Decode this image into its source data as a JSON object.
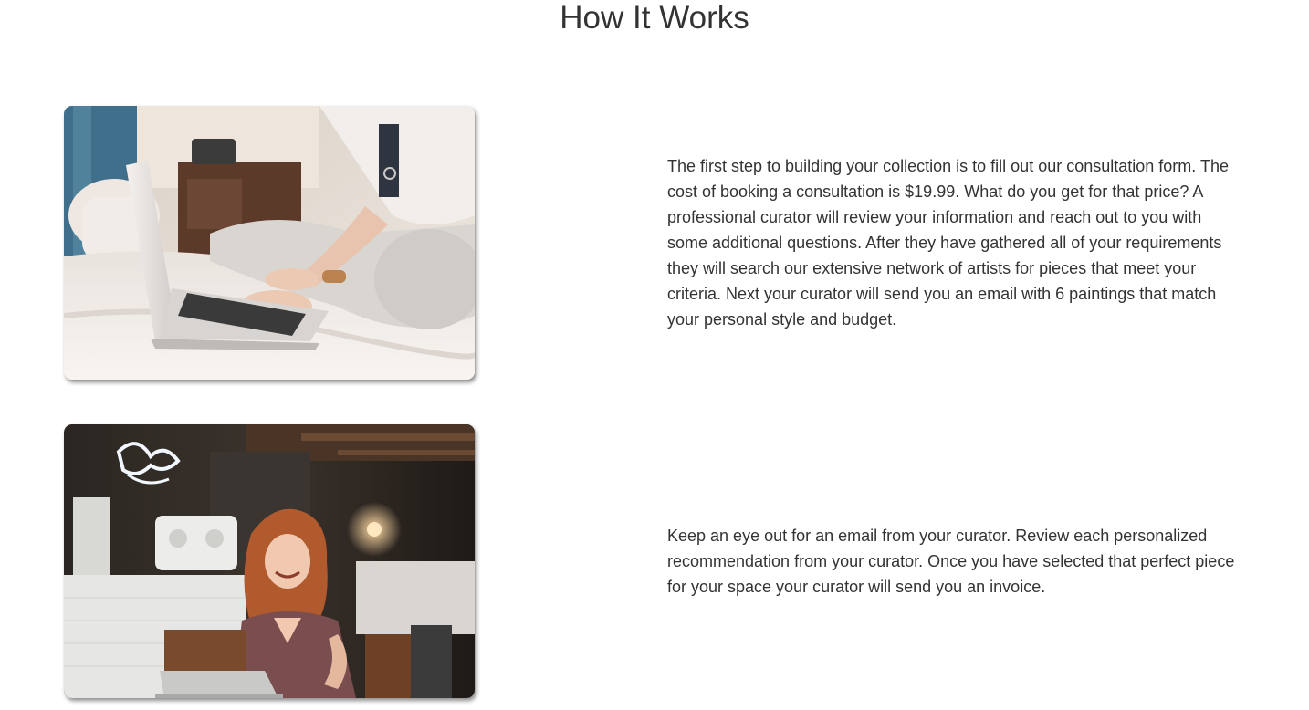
{
  "section": {
    "title": "How It Works"
  },
  "steps": [
    {
      "image_subject": "laptop-on-bed-photo",
      "text": "The first step to building your collection is to fill out our consultation form. The cost of booking a consultation is $19.99. What do you get for that price? A professional curator will review your information and reach out to you with some additional questions. After they have gathered all of your requirements they will search our extensive network of artists for pieces that meet your criteria. Next your curator will send you an email with 6 paintings that match your personal style and budget."
    },
    {
      "image_subject": "woman-in-cafe-with-laptop-photo",
      "text": "Keep an eye out for an email from your curator. Review each personalized recommendation from your curator. Once you have selected that perfect piece for your space your curator will send you an invoice."
    }
  ]
}
